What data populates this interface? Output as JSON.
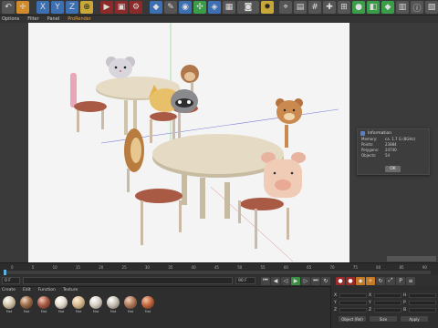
{
  "menubar": {
    "items": [
      "Options",
      "Filter",
      "Panel",
      "ProRender"
    ]
  },
  "toolbar": {
    "axis_labels": [
      "X",
      "Y",
      "Z"
    ]
  },
  "info_dialog": {
    "title": "Information",
    "rows": [
      {
        "key": "Memory:",
        "value": "ca. 1.7 G (8GHz)"
      },
      {
        "key": "Points:",
        "value": "23884"
      },
      {
        "key": "Polygons:",
        "value": "24740"
      },
      {
        "key": "Objects:",
        "value": "54"
      }
    ],
    "ok_label": "OK"
  },
  "timeline": {
    "ticks": [
      "0",
      "5",
      "10",
      "15",
      "20",
      "25",
      "30",
      "35",
      "40",
      "45",
      "50",
      "55",
      "60",
      "65",
      "70",
      "75",
      "80",
      "85",
      "90"
    ],
    "start": "0 F",
    "end": "90 F"
  },
  "materials": {
    "menu": [
      "Create",
      "Edit",
      "Function",
      "Texture"
    ],
    "items": [
      {
        "label": "Mat",
        "color": "#d9cbb0"
      },
      {
        "label": "Mat",
        "color": "#9a6b48"
      },
      {
        "label": "Mat",
        "color": "#a85a45"
      },
      {
        "label": "Mat",
        "color": "#e4dccc"
      },
      {
        "label": "Mat",
        "color": "#d7b98e"
      },
      {
        "label": "Mat",
        "color": "#d8d0c4"
      },
      {
        "label": "Mat",
        "color": "#c8c0b4"
      },
      {
        "label": "Mat",
        "color": "#b07a5a"
      },
      {
        "label": "Mat",
        "color": "#c4673f"
      }
    ]
  },
  "coords": {
    "rows": [
      {
        "a": "X",
        "b": "X",
        "c": "H"
      },
      {
        "a": "Y",
        "b": "Y",
        "c": "P"
      },
      {
        "a": "Z",
        "b": "Z",
        "c": "B"
      }
    ],
    "buttons": [
      "Object (Rel)",
      "Size",
      "Apply"
    ]
  }
}
